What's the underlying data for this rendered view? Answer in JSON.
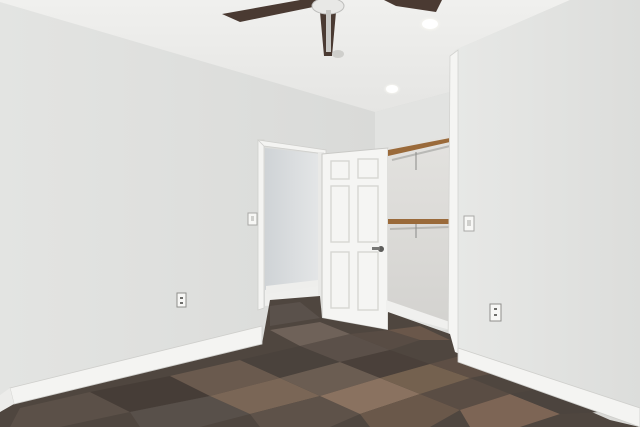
{
  "scene": {
    "subject": "empty room",
    "elements": [
      "ceiling-fan",
      "recessed-light",
      "open-door",
      "walk-in-closet",
      "closet-shelf",
      "closet-rod",
      "light-switch",
      "power-outlet",
      "baseboard",
      "stone-tile-floor"
    ]
  },
  "colors": {
    "wall": "#e6e7e5",
    "wall_shadow": "#cfd0ce",
    "ceiling": "#eeeeec",
    "door": "#f4f4f2",
    "trim": "#f2f2ef",
    "shelf_wood": "#9a6a3a",
    "floor_base": "#4f463f",
    "fan_blade": "#4a3a32"
  }
}
